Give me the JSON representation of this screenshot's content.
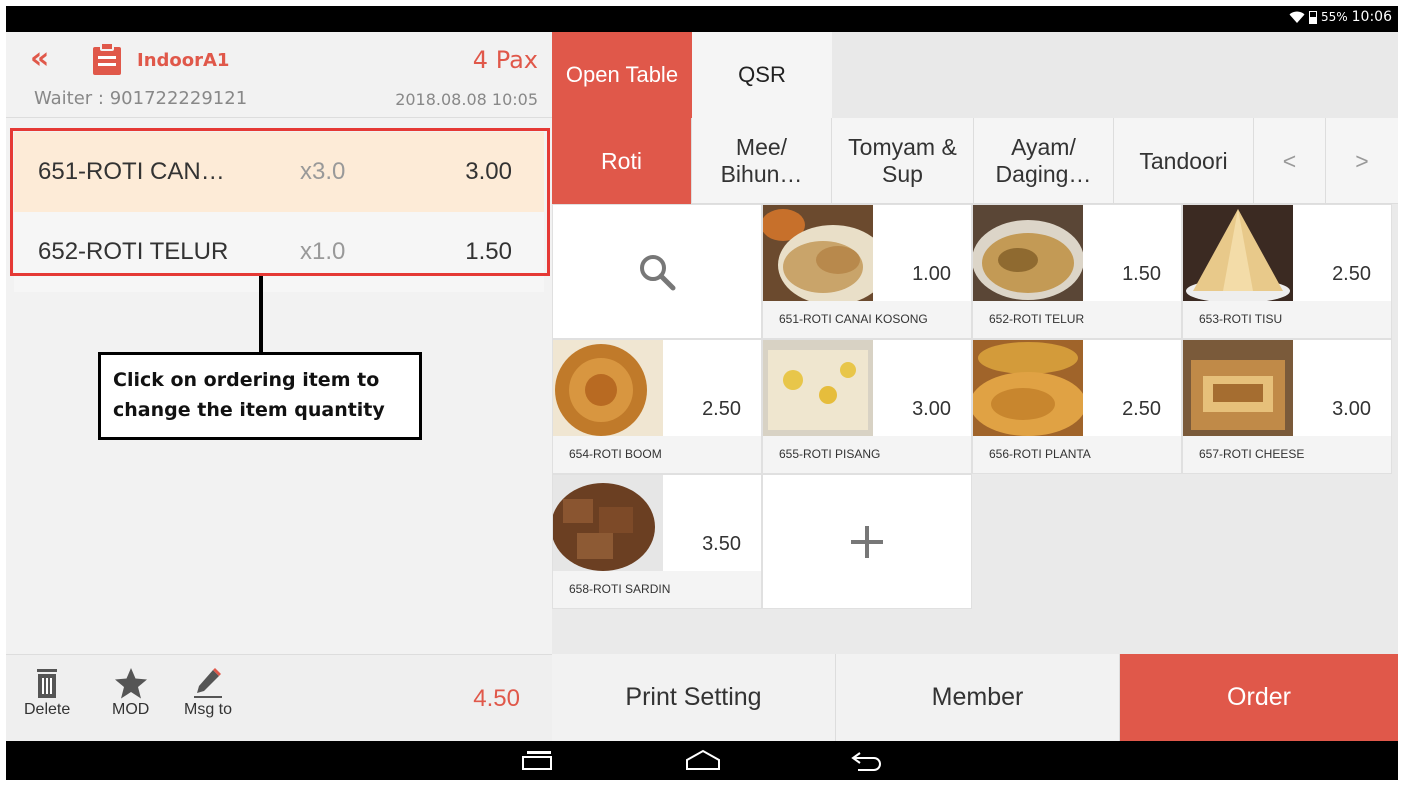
{
  "status_bar": {
    "battery": "55%",
    "time": "10:06"
  },
  "order_header": {
    "table_name": "IndoorA1",
    "pax": "4 Pax",
    "waiter": "Waiter : 901722229121",
    "datetime": "2018.08.08 10:05"
  },
  "order_items": [
    {
      "name": "651-ROTI CAN…",
      "qty": "x3.0",
      "price": "3.00"
    },
    {
      "name": "652-ROTI TELUR",
      "qty": "x1.0",
      "price": "1.50"
    }
  ],
  "callout": {
    "line1": "Click on ordering item to",
    "line2": "change the item quantity"
  },
  "order_footer": {
    "delete": "Delete",
    "mod": "MOD",
    "msg_to": "Msg to",
    "total": "4.50"
  },
  "mode_tabs": [
    "Open Table",
    "QSR"
  ],
  "category_tabs": [
    {
      "line1": "Roti",
      "line2": ""
    },
    {
      "line1": "Mee/",
      "line2": "Bihun…"
    },
    {
      "line1": "Tomyam &",
      "line2": "Sup"
    },
    {
      "line1": "Ayam/",
      "line2": "Daging…"
    },
    {
      "line1": "Tandoori",
      "line2": ""
    }
  ],
  "nav_arrows": {
    "prev": "<",
    "next": ">"
  },
  "menu_items": [
    {
      "name": "651-ROTI CANAI KOSONG",
      "price": "1.00"
    },
    {
      "name": "652-ROTI TELUR",
      "price": "1.50"
    },
    {
      "name": "653-ROTI TISU",
      "price": "2.50"
    },
    {
      "name": "654-ROTI BOOM",
      "price": "2.50"
    },
    {
      "name": "655-ROTI PISANG",
      "price": "3.00"
    },
    {
      "name": "656-ROTI PLANTA",
      "price": "2.50"
    },
    {
      "name": "657-ROTI CHEESE",
      "price": "3.00"
    },
    {
      "name": "658-ROTI SARDIN",
      "price": "3.50"
    }
  ],
  "action_buttons": {
    "print": "Print Setting",
    "member": "Member",
    "order": "Order"
  },
  "colors": {
    "accent": "#e0584a",
    "highlight_border": "#e53935",
    "selected_row": "#fdebd7"
  }
}
